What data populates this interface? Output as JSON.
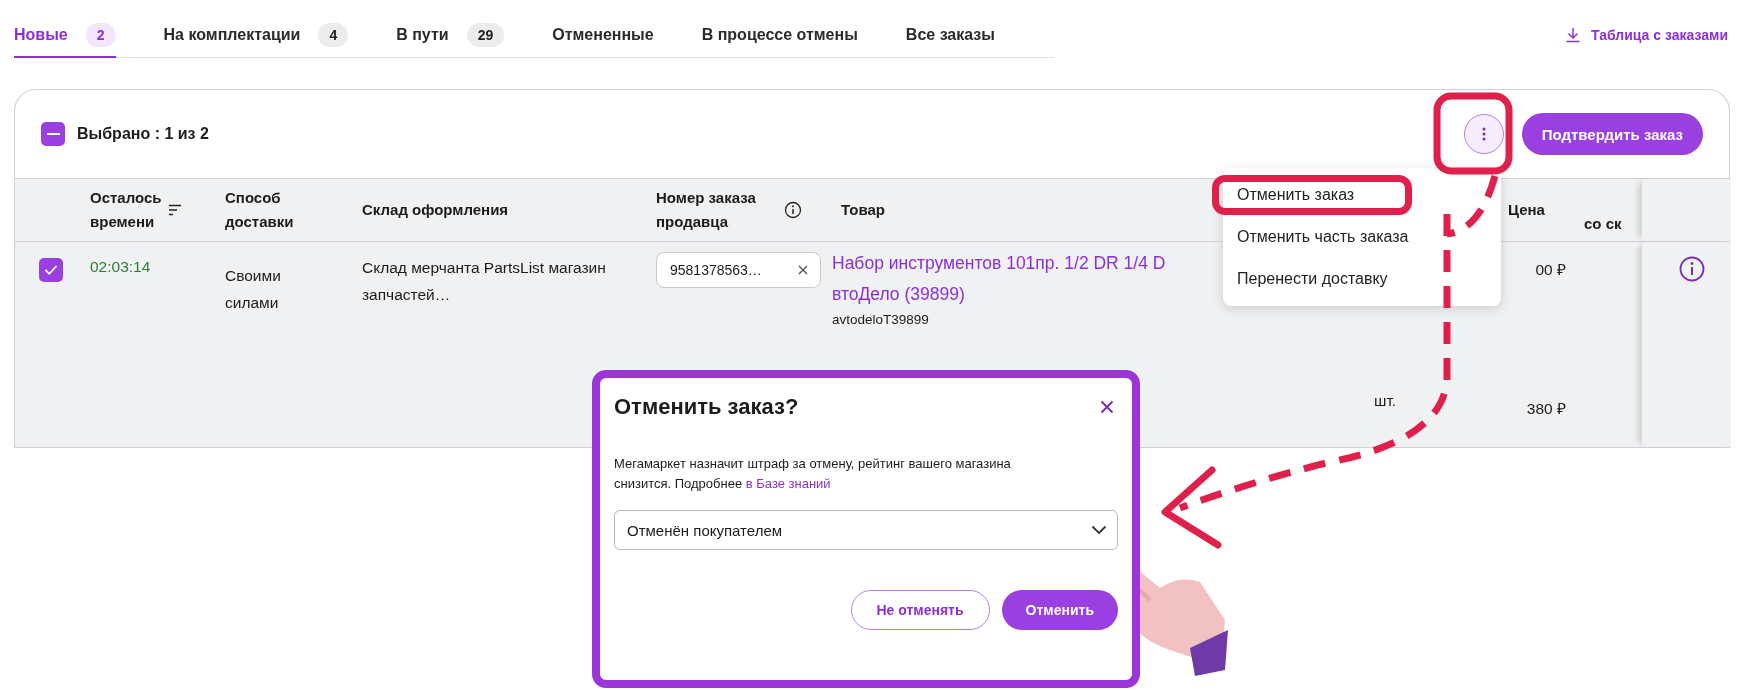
{
  "tabs": [
    {
      "label": "Новые",
      "count": "2",
      "selected": true
    },
    {
      "label": "На комплектации",
      "count": "4",
      "selected": false
    },
    {
      "label": "В пути",
      "count": "29",
      "selected": false
    },
    {
      "label": "Отмененные",
      "selected": false
    },
    {
      "label": "В процессе отмены",
      "selected": false
    },
    {
      "label": "Все заказы",
      "selected": false
    }
  ],
  "export_link": {
    "label": "Таблица с заказами"
  },
  "selection": {
    "label": "Выбрано : 1 из 2",
    "indeterminate": true
  },
  "confirm_button": {
    "label": "Подтвердить заказ"
  },
  "more_menu": {
    "items": [
      {
        "label": "Отменить заказ",
        "highlighted": true
      },
      {
        "label": "Отменить часть заказа",
        "highlighted": false
      },
      {
        "label": "Перенести доставку",
        "highlighted": false
      }
    ]
  },
  "table": {
    "columns": [
      {
        "label": "Осталось времени",
        "kind": "sortable"
      },
      {
        "label": "Способ доставки",
        "kind": "plain"
      },
      {
        "label": "Склад оформления",
        "kind": "plain"
      },
      {
        "label": "Номер заказа продавца",
        "kind": "hint"
      },
      {
        "label": "Товар",
        "kind": "plain"
      },
      {
        "label": "Цена",
        "kind": "plain"
      },
      {
        "label": "со ск",
        "kind": "plain"
      }
    ],
    "rows": [
      {
        "selected": true,
        "time_left": "02:03:14",
        "delivery": "Своими силами",
        "warehouse": "Склад мерчанта PartsList магазин запчастей…",
        "order_number": "9581378563…",
        "product_lines": [
          "Набор инструментов 101пр. 1/2 DR 1/4 D",
          "втоДело (39899)"
        ],
        "sku": "avtodeloT39899",
        "price": "00 ₽",
        "quantity": "шт.",
        "price_2": "380 ₽"
      }
    ]
  },
  "dialog": {
    "title": "Отменить заказ?",
    "text": "Мегамаркет назначит штраф за отмену, рейтинг вашего магазина снизится. Подробнее",
    "link": "в Базе знаний",
    "reason": "Отменён покупателем",
    "buttons": [
      {
        "label": "Не отменять",
        "kind": "secondary"
      },
      {
        "label": "Отменить",
        "kind": "primary"
      }
    ]
  }
}
